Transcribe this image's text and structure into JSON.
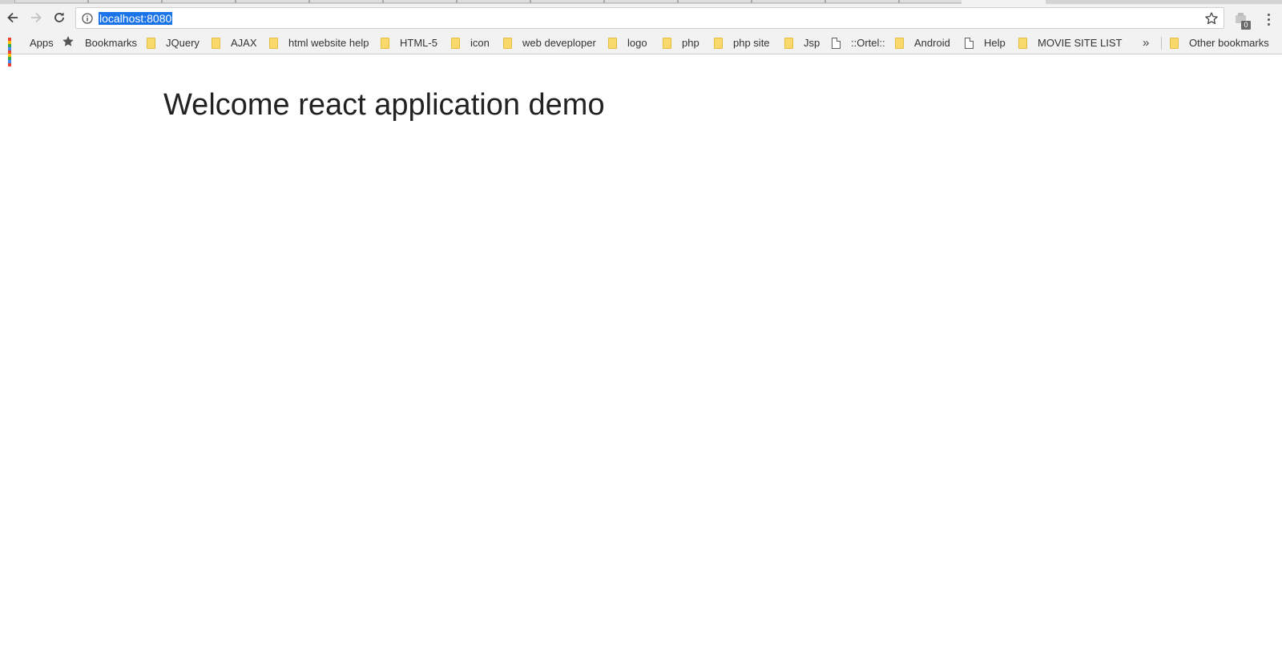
{
  "browser": {
    "address_bar": {
      "url": "localhost:8080"
    },
    "extension": {
      "badge_count": "0"
    },
    "icons": {
      "back": "arrow-left-icon",
      "forward": "arrow-right-icon",
      "reload": "reload-icon",
      "info": "info-icon",
      "bookmark_star": "star-outline-icon",
      "menu": "kebab-menu-icon"
    }
  },
  "bookmarks_bar": {
    "apps_label": "Apps",
    "items": [
      {
        "label": "Bookmarks",
        "icon": "star-icon"
      },
      {
        "label": "JQuery",
        "icon": "folder-icon"
      },
      {
        "label": "AJAX",
        "icon": "folder-icon"
      },
      {
        "label": "html website help",
        "icon": "folder-icon"
      },
      {
        "label": "HTML-5",
        "icon": "folder-icon"
      },
      {
        "label": "icon",
        "icon": "folder-icon"
      },
      {
        "label": "web deveploper",
        "icon": "folder-icon"
      },
      {
        "label": "logo",
        "icon": "folder-icon"
      },
      {
        "label": "php",
        "icon": "folder-icon"
      },
      {
        "label": "php site",
        "icon": "folder-icon"
      },
      {
        "label": "Jsp",
        "icon": "folder-icon"
      },
      {
        "label": "::Ortel::",
        "icon": "page-icon"
      },
      {
        "label": "Android",
        "icon": "folder-icon"
      },
      {
        "label": "Help",
        "icon": "page-icon"
      },
      {
        "label": "MOVIE SITE LIST",
        "icon": "folder-icon"
      }
    ],
    "overflow_label": "»",
    "other_bookmarks_label": "Other bookmarks"
  },
  "page": {
    "heading": "Welcome react application demo"
  },
  "colors": {
    "chrome_bg": "#f2f2f2",
    "url_highlight": "#1a73e8",
    "folder": "#f9d96b",
    "heading_text": "#222222"
  }
}
